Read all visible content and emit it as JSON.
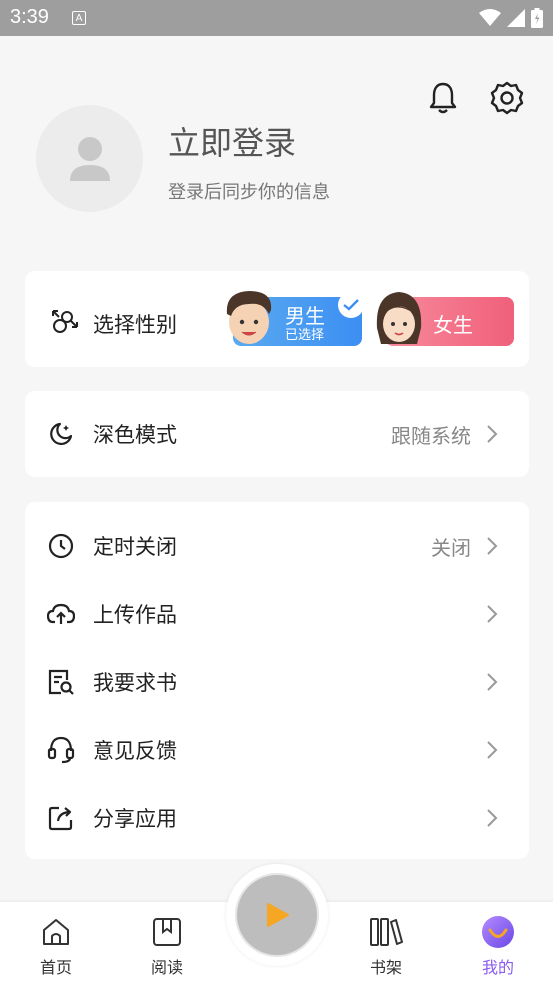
{
  "status_bar": {
    "time": "3:39",
    "a_badge": "A"
  },
  "header": {
    "icons": [
      "bell-icon",
      "gear-icon"
    ],
    "login_title": "立即登录",
    "login_subtitle": "登录后同步你的信息"
  },
  "gender": {
    "label": "选择性别",
    "male": {
      "title": "男生",
      "status": "已选择",
      "selected": true
    },
    "female": {
      "title": "女生",
      "selected": false
    }
  },
  "dark_mode": {
    "label": "深色模式",
    "value": "跟随系统"
  },
  "menu": [
    {
      "label": "定时关闭",
      "value": "关闭",
      "icon": "clock-icon"
    },
    {
      "label": "上传作品",
      "value": "",
      "icon": "upload-cloud-icon"
    },
    {
      "label": "我要求书",
      "value": "",
      "icon": "book-search-icon"
    },
    {
      "label": "意见反馈",
      "value": "",
      "icon": "headset-icon"
    },
    {
      "label": "分享应用",
      "value": "",
      "icon": "share-icon"
    }
  ],
  "bottom_nav": {
    "items": [
      {
        "label": "首页",
        "icon": "home-icon"
      },
      {
        "label": "阅读",
        "icon": "book-icon"
      },
      {
        "label": "书架",
        "icon": "bookshelf-icon"
      },
      {
        "label": "我的",
        "icon": "profile-icon"
      }
    ],
    "active_index": 3
  },
  "colors": {
    "accent": "#8a5cf0",
    "male": "#3c8ff2",
    "female": "#f0607a",
    "play": "#f5a623"
  }
}
